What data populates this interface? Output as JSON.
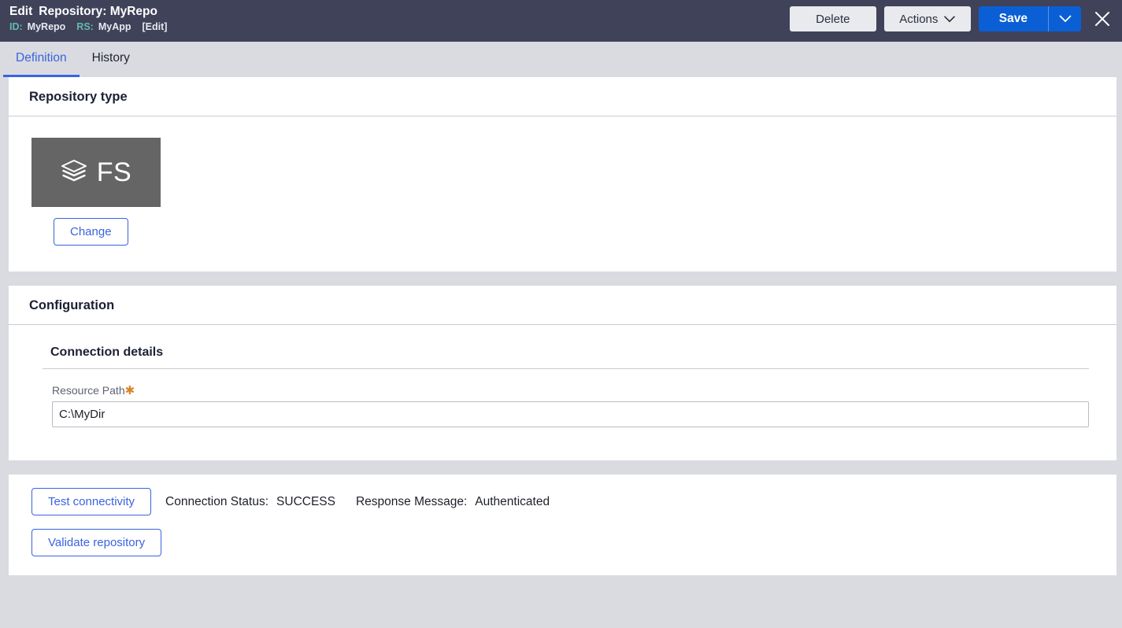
{
  "header": {
    "action_word": "Edit",
    "title": "Repository: MyRepo",
    "id_label": "ID:",
    "id_value": "MyRepo",
    "rs_label": "RS:",
    "rs_value": "MyApp",
    "edit_link": "[Edit]",
    "delete_label": "Delete",
    "actions_label": "Actions",
    "save_label": "Save",
    "close_icon": "close-icon",
    "caret_icon": "chevron-down-icon"
  },
  "tabs": [
    {
      "label": "Definition",
      "active": true
    },
    {
      "label": "History",
      "active": false
    }
  ],
  "repository_type": {
    "card_title": "Repository type",
    "tile_icon": "layers-icon",
    "tile_label": "FS",
    "change_label": "Change"
  },
  "configuration": {
    "card_title": "Configuration",
    "section_title": "Connection details",
    "fields": [
      {
        "label": "Resource Path",
        "required": true,
        "required_marker": "✱",
        "value": "C:\\MyDir",
        "placeholder": ""
      }
    ]
  },
  "actions_panel": {
    "test_connectivity_label": "Test connectivity",
    "validate_repository_label": "Validate repository",
    "connection_status_label": "Connection Status:",
    "connection_status_value": "SUCCESS",
    "response_message_label": "Response Message:",
    "response_message_value": "Authenticated"
  },
  "colors": {
    "header_bg": "#3f4259",
    "accent_blue": "#0b5fd4",
    "link_blue": "#3a63e0",
    "teal_label": "#63b9ae",
    "page_bg": "#d9dbe0",
    "tile_gray": "#656565",
    "required_orange": "#d98528"
  }
}
